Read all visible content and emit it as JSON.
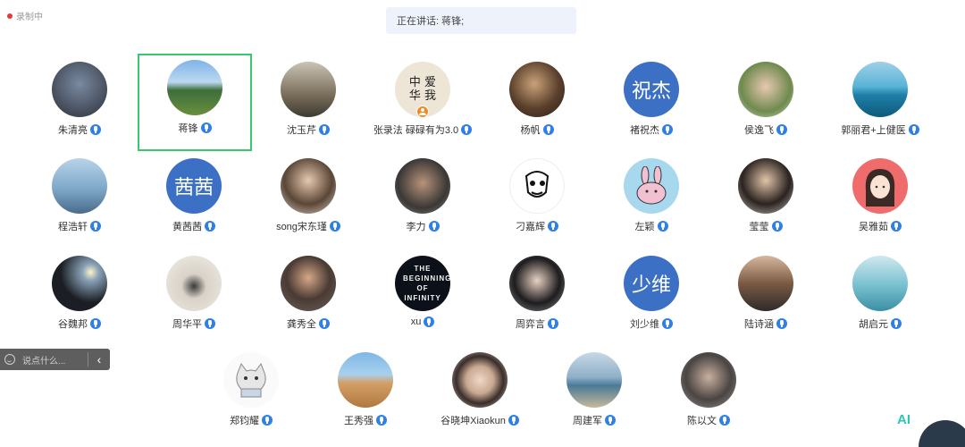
{
  "status": {
    "recording_label": "录制中"
  },
  "speaker_banner": {
    "text": "正在讲话: 蒋锋;"
  },
  "participants": [
    {
      "name": "朱清亮"
    },
    {
      "name": "蒋锋"
    },
    {
      "name": "沈玉芹"
    },
    {
      "name": "张录法 碌碌有为3.0",
      "host": true,
      "avatar_text": "中 爱 华 我"
    },
    {
      "name": "杨帆"
    },
    {
      "name": "褚祝杰",
      "avatar_text": "祝杰"
    },
    {
      "name": "侯逸飞"
    },
    {
      "name": "郭丽君+上健医"
    },
    {
      "name": "程浩轩"
    },
    {
      "name": "黄茜茜",
      "avatar_text": "茜茜"
    },
    {
      "name": "song宋东瑾"
    },
    {
      "name": "李力"
    },
    {
      "name": "刁嘉辉"
    },
    {
      "name": "左颖"
    },
    {
      "name": "莹莹"
    },
    {
      "name": "吴雅茹"
    },
    {
      "name": "谷魏邦"
    },
    {
      "name": "周华平"
    },
    {
      "name": "龚秀全"
    },
    {
      "name": "xu",
      "avatar_text": "THE BEGINNING OF INFINITY"
    },
    {
      "name": "周弈言"
    },
    {
      "name": "刘少维",
      "avatar_text": "少维"
    },
    {
      "name": "陆诗涵"
    },
    {
      "name": "胡启元"
    },
    {
      "name": "郑钧耀"
    },
    {
      "name": "王秀强"
    },
    {
      "name": "谷晓坤Xiaokun"
    },
    {
      "name": "周建军"
    },
    {
      "name": "陈以文"
    }
  ],
  "chat_bar": {
    "placeholder": "说点什么...",
    "collapse_icon": "‹"
  },
  "ai_badge": "AI",
  "colors": {
    "accent_blue": "#2f7fe7",
    "selected_border": "#3cc56f",
    "text_avatar_bg": "#3c70c4"
  }
}
